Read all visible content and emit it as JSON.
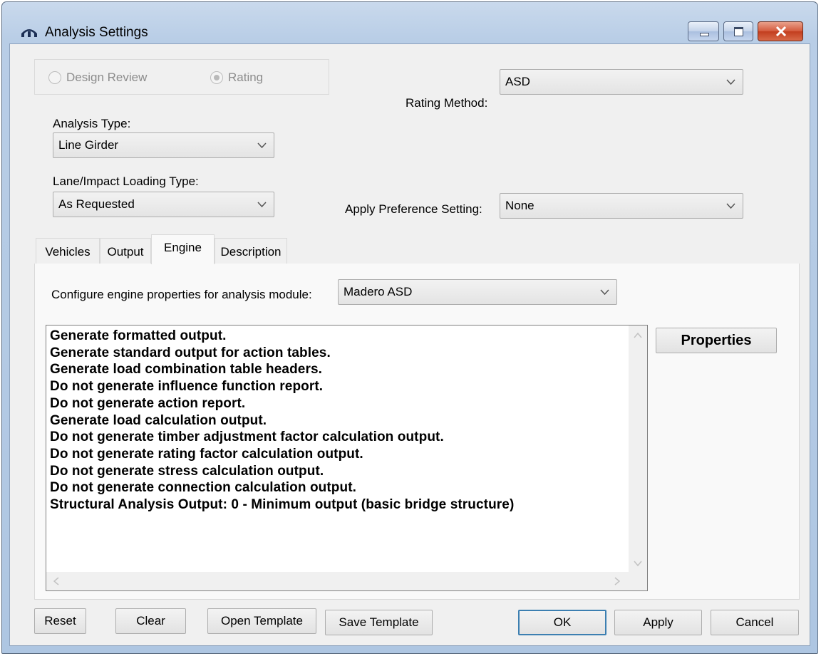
{
  "window": {
    "title": "Analysis Settings"
  },
  "mode": {
    "design_review_label": "Design Review",
    "rating_label": "Rating",
    "selected": "Rating"
  },
  "rating_method": {
    "label": "Rating Method:",
    "value": "ASD"
  },
  "analysis_type": {
    "label": "Analysis Type:",
    "value": "Line Girder"
  },
  "lane_impact": {
    "label": "Lane/Impact Loading Type:",
    "value": "As Requested"
  },
  "preference": {
    "label": "Apply Preference Setting:",
    "value": "None"
  },
  "tabs": [
    {
      "label": "Vehicles",
      "active": false
    },
    {
      "label": "Output",
      "active": false
    },
    {
      "label": "Engine",
      "active": true
    },
    {
      "label": "Description",
      "active": false
    }
  ],
  "engine": {
    "module_label": "Configure engine properties for analysis module:",
    "module_value": "Madero ASD",
    "properties_label": "Properties",
    "items": [
      "Generate formatted output.",
      "Generate standard output for action tables.",
      "Generate load combination table headers.",
      "Do not generate influence function report.",
      "Do not generate action report.",
      "Generate load calculation output.",
      "Do not generate timber adjustment factor calculation output.",
      "Do not generate rating factor calculation output.",
      "Do not generate stress calculation output.",
      "Do not generate connection calculation output.",
      "Structural Analysis Output: 0 - Minimum output (basic bridge structure)"
    ]
  },
  "buttons": {
    "reset": "Reset",
    "clear": "Clear",
    "open_template": "Open Template",
    "save_template": "Save Template",
    "ok": "OK",
    "apply": "Apply",
    "cancel": "Cancel"
  },
  "colors": {
    "focus_border": "#3c7fb1",
    "close_button": "#c23d1e",
    "title_bar": "#b8cde6"
  }
}
